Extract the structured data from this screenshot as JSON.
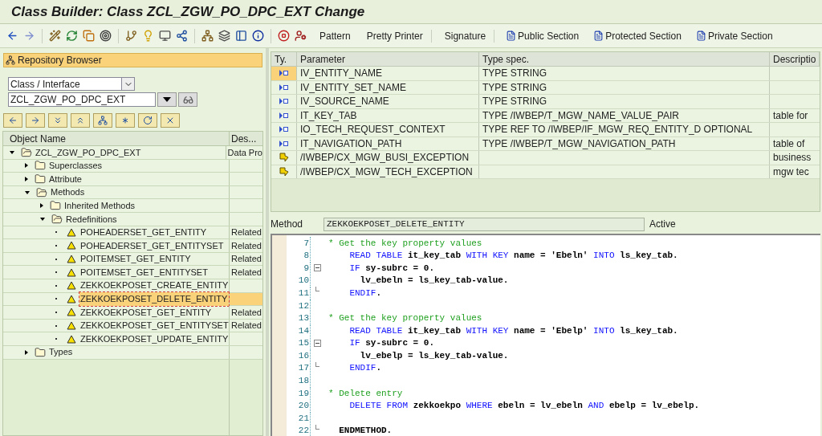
{
  "window": {
    "title": "Class Builder: Class ZCL_ZGW_PO_DPC_EXT Change"
  },
  "toolbar": {
    "buttons": [
      "Pattern",
      "Pretty Printer",
      "Signature"
    ],
    "sections": [
      "Public Section",
      "Protected Section",
      "Private Section"
    ]
  },
  "repository_browser": {
    "title": "Repository Browser",
    "object_type": "Class / Interface",
    "object_name": "ZCL_ZGW_PO_DPC_EXT",
    "columns": [
      "Object Name",
      "Des..."
    ],
    "tree": [
      {
        "label": "ZCL_ZGW_PO_DPC_EXT",
        "description": "Data Pro",
        "expanded": true,
        "children": [
          {
            "label": "Superclasses",
            "expanded": false
          },
          {
            "label": "Attribute",
            "expanded": false
          },
          {
            "label": "Methods",
            "expanded": true,
            "children": [
              {
                "label": "Inherited Methods",
                "expanded": false
              },
              {
                "label": "Redefinitions",
                "expanded": true,
                "children": [
                  {
                    "label": "POHEADERSET_GET_ENTITY",
                    "description": "Related",
                    "selected": false
                  },
                  {
                    "label": "POHEADERSET_GET_ENTITYSET",
                    "description": "Related",
                    "selected": false
                  },
                  {
                    "label": "POITEMSET_GET_ENTITY",
                    "description": "Related",
                    "selected": false
                  },
                  {
                    "label": "POITEMSET_GET_ENTITYSET",
                    "description": "Related",
                    "selected": false
                  },
                  {
                    "label": "ZEKKOEKPOSET_CREATE_ENTITY",
                    "selected": false
                  },
                  {
                    "label": "ZEKKOEKPOSET_DELETE_ENTITY",
                    "selected": true
                  },
                  {
                    "label": "ZEKKOEKPOSET_GET_ENTITY",
                    "description": "Related",
                    "selected": false
                  },
                  {
                    "label": "ZEKKOEKPOSET_GET_ENTITYSET",
                    "description": "Related",
                    "selected": false
                  },
                  {
                    "label": "ZEKKOEKPOSET_UPDATE_ENTITY",
                    "selected": false
                  }
                ]
              }
            ]
          },
          {
            "label": "Types",
            "expanded": false
          }
        ]
      }
    ]
  },
  "parameters": {
    "columns": [
      "Ty.",
      "Parameter",
      "Type spec.",
      "Descriptio"
    ],
    "rows": [
      {
        "kind": "importing",
        "parameter": "IV_ENTITY_NAME",
        "type_spec": "TYPE STRING",
        "selected": true
      },
      {
        "kind": "importing",
        "parameter": "IV_ENTITY_SET_NAME",
        "type_spec": "TYPE STRING",
        "selected": false
      },
      {
        "kind": "importing",
        "parameter": "IV_SOURCE_NAME",
        "type_spec": "TYPE STRING",
        "selected": false
      },
      {
        "kind": "importing",
        "parameter": "IT_KEY_TAB",
        "type_spec": "TYPE /IWBEP/T_MGW_NAME_VALUE_PAIR",
        "description": "table for",
        "selected": false
      },
      {
        "kind": "importing",
        "parameter": "IO_TECH_REQUEST_CONTEXT",
        "type_spec": "TYPE REF TO /IWBEP/IF_MGW_REQ_ENTITY_D OPTIONAL",
        "selected": false
      },
      {
        "kind": "importing",
        "parameter": "IT_NAVIGATION_PATH",
        "type_spec": "TYPE /IWBEP/T_MGW_NAVIGATION_PATH",
        "description": "table of",
        "selected": false
      },
      {
        "kind": "exception",
        "parameter": "/IWBEP/CX_MGW_BUSI_EXCEPTION",
        "description": "business",
        "selected": false
      },
      {
        "kind": "exception",
        "parameter": "/IWBEP/CX_MGW_TECH_EXCEPTION",
        "description": "mgw tec",
        "selected": false
      }
    ]
  },
  "method_bar": {
    "label": "Method",
    "value": "ZEKKOEKPOSET_DELETE_ENTITY",
    "status": "Active"
  },
  "editor": {
    "lines": [
      {
        "number": "7",
        "tokens": [
          {
            "kind": "comment",
            "text": "* Get the key property values"
          }
        ]
      },
      {
        "number": "8",
        "tokens": [
          {
            "kind": "keyword",
            "text": "    READ TABLE"
          },
          {
            "kind": "plain",
            "text": " it_key_tab "
          },
          {
            "kind": "keyword",
            "text": "WITH KEY"
          },
          {
            "kind": "plain",
            "text": " name = 'Ebeln' "
          },
          {
            "kind": "keyword",
            "text": "INTO"
          },
          {
            "kind": "plain",
            "text": " ls_key_tab."
          }
        ]
      },
      {
        "number": "9",
        "fold_start": true,
        "tokens": [
          {
            "kind": "keyword",
            "text": "    IF"
          },
          {
            "kind": "plain",
            "text": " sy-subrc = 0."
          }
        ]
      },
      {
        "number": "10",
        "tokens": [
          {
            "kind": "plain",
            "text": "      lv_ebeln = ls_key_tab-value."
          }
        ]
      },
      {
        "number": "11",
        "fold_end": true,
        "tokens": [
          {
            "kind": "keyword",
            "text": "    ENDIF"
          },
          {
            "kind": "plain",
            "text": "."
          }
        ]
      },
      {
        "number": "12"
      },
      {
        "number": "13",
        "tokens": [
          {
            "kind": "comment",
            "text": "* Get the key property values"
          }
        ]
      },
      {
        "number": "14",
        "tokens": [
          {
            "kind": "keyword",
            "text": "    READ TABLE"
          },
          {
            "kind": "plain",
            "text": " it_key_tab "
          },
          {
            "kind": "keyword",
            "text": "WITH KEY"
          },
          {
            "kind": "plain",
            "text": " name = 'Ebelp' "
          },
          {
            "kind": "keyword",
            "text": "INTO"
          },
          {
            "kind": "plain",
            "text": " ls_key_tab."
          }
        ]
      },
      {
        "number": "15",
        "fold_start": true,
        "tokens": [
          {
            "kind": "keyword",
            "text": "    IF"
          },
          {
            "kind": "plain",
            "text": " sy-subrc = 0."
          }
        ]
      },
      {
        "number": "16",
        "tokens": [
          {
            "kind": "plain",
            "text": "      lv_ebelp = ls_key_tab-value."
          }
        ]
      },
      {
        "number": "17",
        "fold_end": true,
        "tokens": [
          {
            "kind": "keyword",
            "text": "    ENDIF"
          },
          {
            "kind": "plain",
            "text": "."
          }
        ]
      },
      {
        "number": "18"
      },
      {
        "number": "19",
        "tokens": [
          {
            "kind": "comment",
            "text": "* Delete entry"
          }
        ]
      },
      {
        "number": "20",
        "tokens": [
          {
            "kind": "keyword",
            "text": "    DELETE FROM"
          },
          {
            "kind": "plain",
            "text": " zekkoekpo "
          },
          {
            "kind": "keyword",
            "text": "WHERE"
          },
          {
            "kind": "plain",
            "text": " ebeln = lv_ebeln "
          },
          {
            "kind": "keyword",
            "text": "AND"
          },
          {
            "kind": "plain",
            "text": " ebelp = lv_ebelp."
          }
        ]
      },
      {
        "number": "21"
      },
      {
        "number": "22",
        "fold_end": true,
        "tokens": [
          {
            "kind": "plain",
            "text": "  ENDMETHOD."
          }
        ]
      }
    ]
  }
}
